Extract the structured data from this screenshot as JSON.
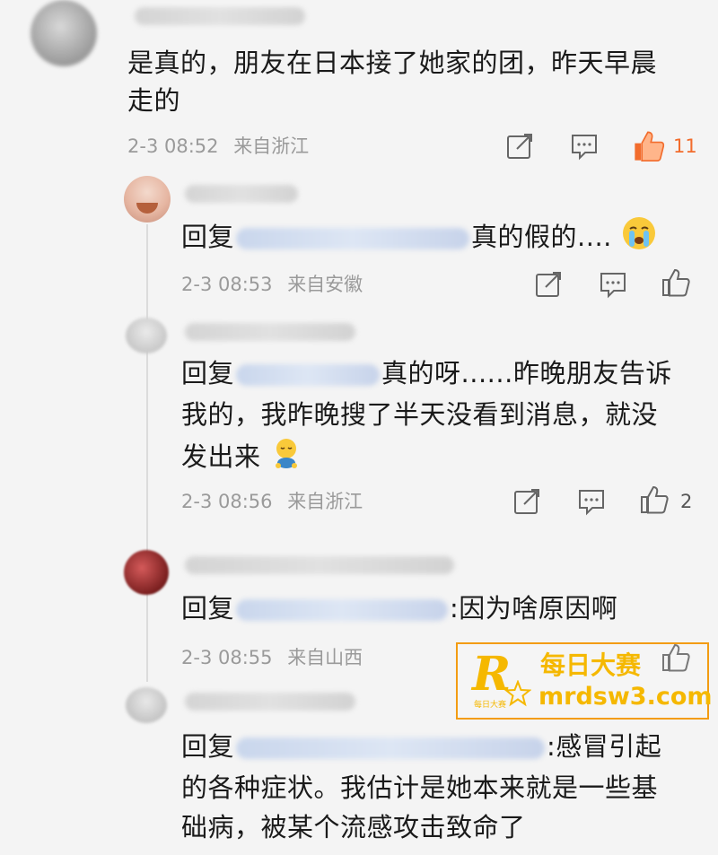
{
  "main_comment": {
    "text_line1": "是真的，朋友在日本接了她家的团，昨天早晨",
    "text_line2": "走的",
    "time": "2-3 08:52",
    "location": "来自浙江",
    "likes": "11"
  },
  "replies": [
    {
      "prefix": "回复",
      "suffix": "真的假的....",
      "time": "2-3 08:53",
      "location": "来自安徽"
    },
    {
      "prefix": "回复",
      "suffix": "真的呀......昨晚朋友告诉",
      "line2": "我的，我昨晚搜了半天没看到消息，就没",
      "line3": "发出来",
      "time": "2-3 08:56",
      "location": "来自浙江",
      "likes": "2"
    },
    {
      "prefix": "回复",
      "suffix": ":因为啥原因啊",
      "time": "2-3 08:55",
      "location": "来自山西"
    },
    {
      "prefix": "回复",
      "suffix": ":感冒引起",
      "line2": "的各种症状。我估计是她本来就是一些基",
      "line3": "础病，被某个流感攻击致命了"
    }
  ],
  "watermark": {
    "letter": "R",
    "small": "每日大赛",
    "cn": "每日大赛",
    "url": "mrdsw3.com"
  },
  "colors": {
    "hot_like": "#f26c2c",
    "meta": "#9a9a9a",
    "watermark": "#f5b800"
  },
  "icons": [
    "share-icon",
    "comment-icon",
    "like-icon",
    "crying-emoji-icon",
    "shy-emoji-icon"
  ]
}
